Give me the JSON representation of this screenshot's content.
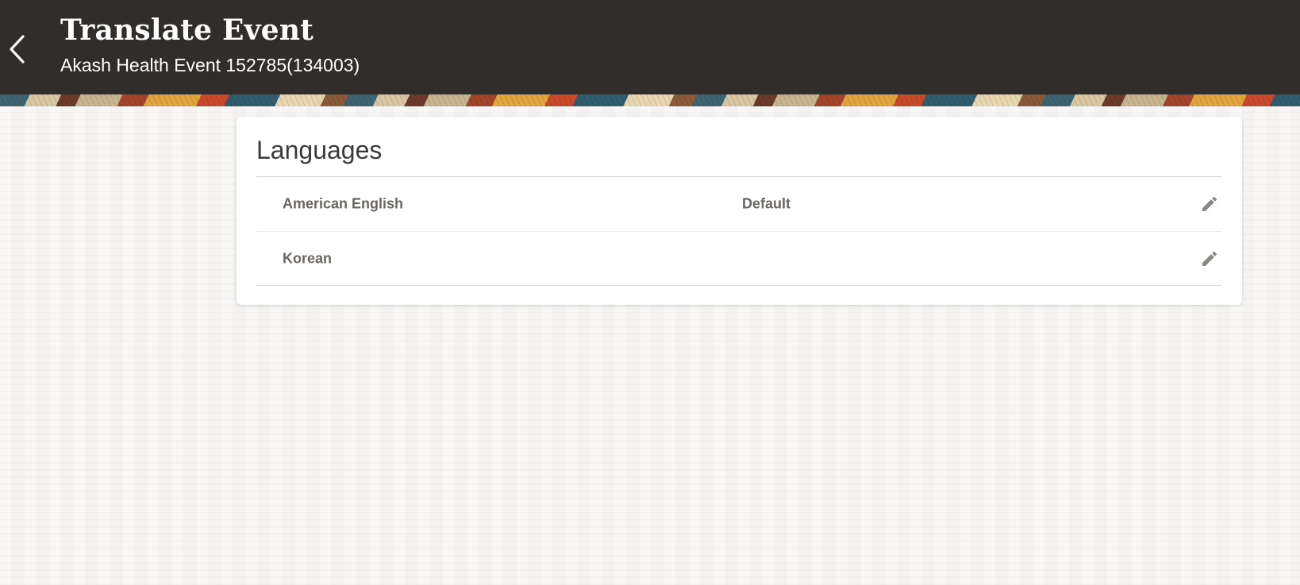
{
  "header": {
    "title": "Translate Event",
    "subtitle": "Akash Health Event 152785(134003)",
    "back_icon": "chevron-left-icon"
  },
  "languages": {
    "title": "Languages",
    "rows": [
      {
        "name": "American English",
        "status": "Default",
        "action_icon": "pencil-icon"
      },
      {
        "name": "Korean",
        "status": "",
        "action_icon": "pencil-icon"
      }
    ]
  },
  "colors": {
    "header_background": "#312d2a",
    "page_background": "#f4f3f1",
    "card_background": "#ffffff",
    "row_text": "#6a6662",
    "icon": "#8a8683"
  }
}
